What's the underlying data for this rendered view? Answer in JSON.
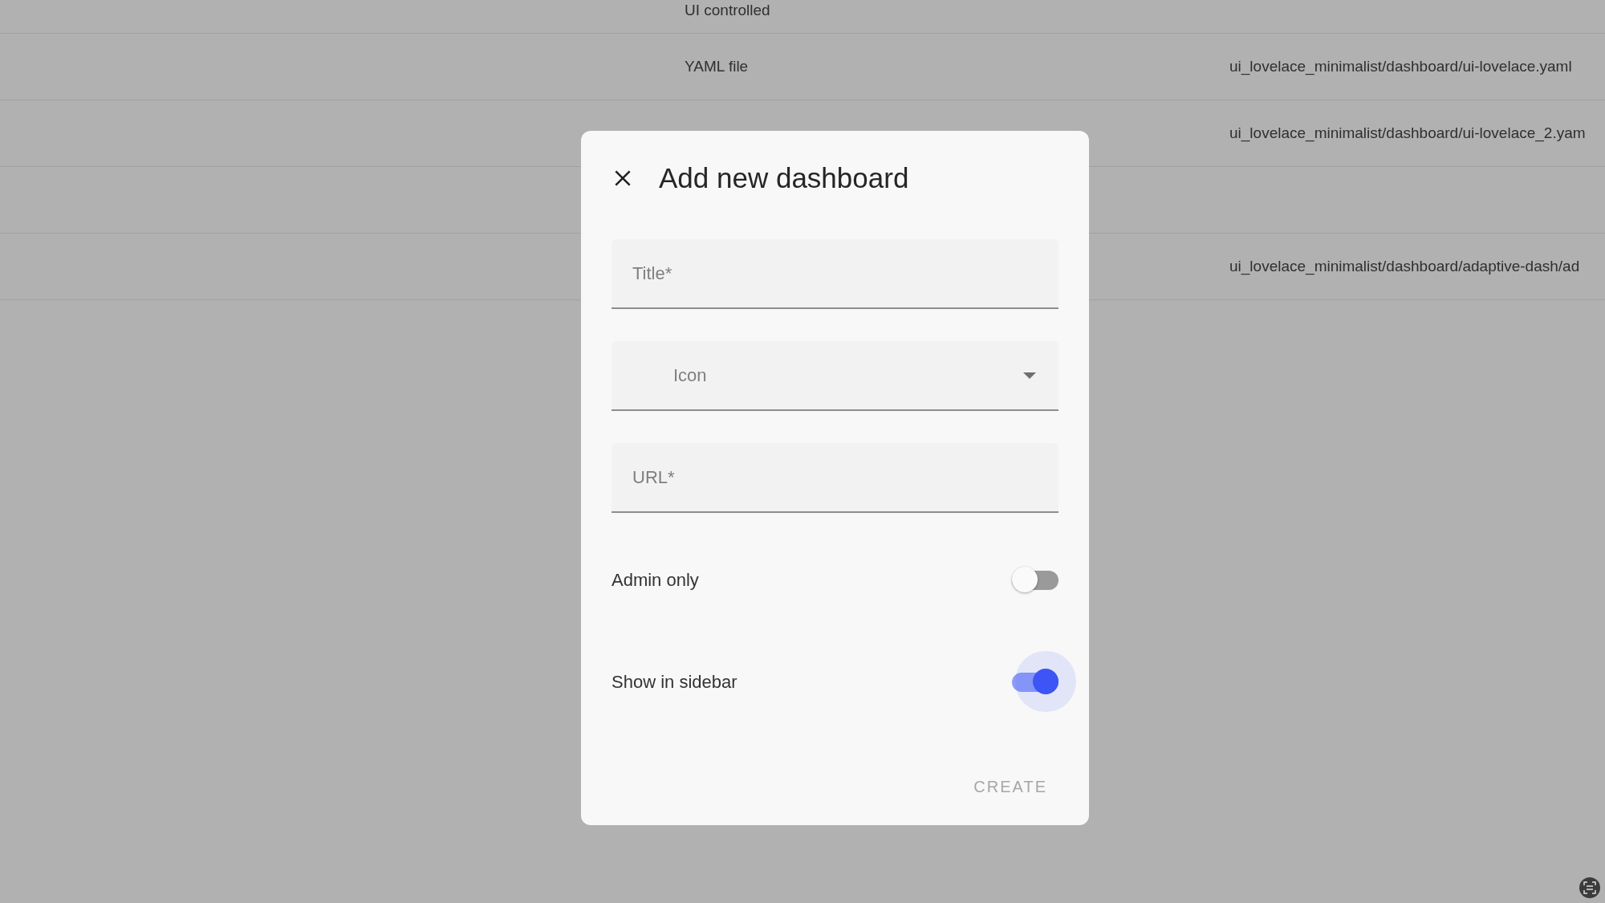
{
  "table": {
    "rows": [
      {
        "column_1": "UI controlled"
      },
      {
        "column_1": "YAML file",
        "column_2": "ui_lovelace_minimalist/dashboard/ui-lovelace.yaml"
      },
      {
        "column_2": "ui_lovelace_minimalist/dashboard/ui-lovelace_2.yam"
      },
      {},
      {
        "column_2": "ui_lovelace_minimalist/dashboard/adaptive-dash/ad"
      }
    ]
  },
  "dialog": {
    "title": "Add new dashboard",
    "fields": [
      {
        "kind": "text",
        "placeholder": "Title*"
      },
      {
        "kind": "select",
        "placeholder": "Icon"
      },
      {
        "kind": "text",
        "placeholder": "URL*"
      }
    ],
    "toggles": [
      {
        "label": "Admin only",
        "on": false,
        "focused": false
      },
      {
        "label": "Show in sidebar",
        "on": true,
        "focused": true
      }
    ],
    "button": {
      "label": "CREATE",
      "disabled": true
    }
  }
}
